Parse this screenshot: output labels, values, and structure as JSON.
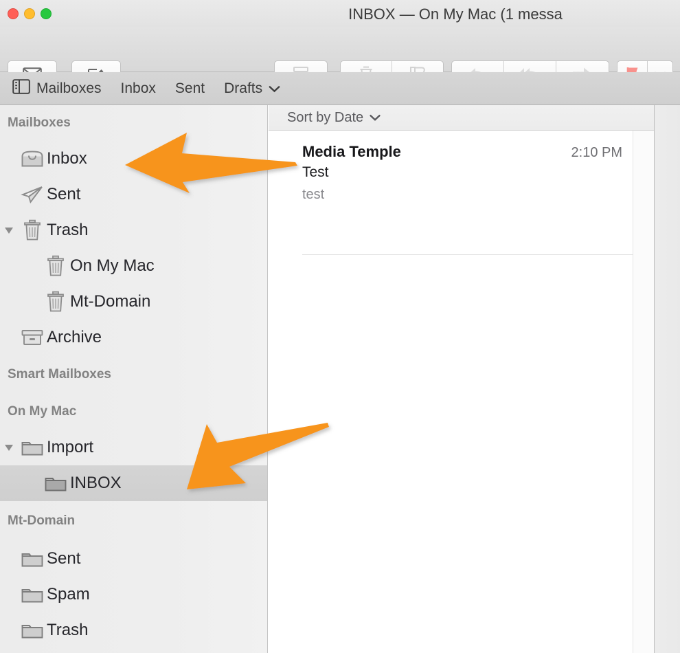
{
  "window": {
    "title": "INBOX — On My Mac (1 messa",
    "traffic_lights": [
      "close-red",
      "minimize-yellow",
      "maximize-green"
    ],
    "colors": {
      "close": "#ff5f57",
      "minimize": "#ffbd2e",
      "maximize": "#28c840",
      "annotation_arrow": "#f7941e",
      "flag": "#f9918c",
      "sidebar_selection": "#d2d2d2"
    }
  },
  "toolbar": {
    "buttons": [
      {
        "name": "get-mail-button",
        "icon": "envelope-icon",
        "label": "Get Mail",
        "enabled": true
      },
      {
        "name": "compose-button",
        "icon": "compose-pencil-icon",
        "label": "New Message",
        "enabled": true
      },
      {
        "name": "archive-button",
        "icon": "archive-box-icon",
        "label": "Archive",
        "enabled": false
      },
      {
        "name": "delete-button",
        "icon": "trash-icon",
        "label": "Delete",
        "enabled": false
      },
      {
        "name": "junk-button",
        "icon": "thumbs-down-icon",
        "label": "Junk",
        "enabled": false
      },
      {
        "name": "reply-button",
        "icon": "reply-arrow-icon",
        "label": "Reply",
        "enabled": false
      },
      {
        "name": "reply-all-button",
        "icon": "reply-all-arrow-icon",
        "label": "Reply All",
        "enabled": false
      },
      {
        "name": "forward-button",
        "icon": "forward-arrow-icon",
        "label": "Forward",
        "enabled": false
      },
      {
        "name": "flag-button",
        "icon": "flag-icon",
        "label": "Flag",
        "enabled": true
      },
      {
        "name": "flag-dropdown-button",
        "icon": "chevron-down-icon",
        "label": "Flag Options",
        "enabled": true
      }
    ]
  },
  "favorites_bar": {
    "sidebar_toggle": {
      "icon": "sidebar-panel-icon",
      "label": ""
    },
    "items": [
      {
        "label": "Mailboxes",
        "icon": "sidebar-panel-icon",
        "active": false
      },
      {
        "label": "Inbox",
        "icon": "",
        "active": false
      },
      {
        "label": "Sent",
        "icon": "",
        "active": false
      },
      {
        "label": "Drafts",
        "icon": "chevron-down-icon",
        "active": false
      }
    ]
  },
  "sidebar": {
    "sections": [
      {
        "header": "Mailboxes",
        "rows": [
          {
            "label": "Inbox",
            "icon": "inbox-tray-icon",
            "indent": 0,
            "disclosure": "",
            "selected": false
          },
          {
            "label": "Sent",
            "icon": "paper-plane-icon",
            "indent": 0,
            "disclosure": "",
            "selected": false
          },
          {
            "label": "Trash",
            "icon": "trash-icon",
            "indent": 0,
            "disclosure": "expanded",
            "selected": false
          },
          {
            "label": "On My Mac",
            "icon": "trash-icon",
            "indent": 2,
            "disclosure": "",
            "selected": false
          },
          {
            "label": "Mt-Domain",
            "icon": "trash-icon",
            "indent": 2,
            "disclosure": "",
            "selected": false
          },
          {
            "label": "Archive",
            "icon": "archive-box-icon",
            "indent": 0,
            "disclosure": "",
            "selected": false
          }
        ]
      },
      {
        "header": "Smart Mailboxes",
        "rows": []
      },
      {
        "header": "On My Mac",
        "rows": [
          {
            "label": "Import",
            "icon": "folder-icon",
            "indent": 0,
            "disclosure": "expanded",
            "selected": false
          },
          {
            "label": "INBOX",
            "icon": "folder-icon",
            "indent": 2,
            "disclosure": "",
            "selected": true
          }
        ]
      },
      {
        "header": "Mt-Domain",
        "rows": [
          {
            "label": "Sent",
            "icon": "folder-icon",
            "indent": 1,
            "disclosure": "",
            "selected": false
          },
          {
            "label": "Spam",
            "icon": "folder-icon",
            "indent": 1,
            "disclosure": "",
            "selected": false
          },
          {
            "label": "Trash",
            "icon": "folder-icon",
            "indent": 1,
            "disclosure": "",
            "selected": false
          }
        ]
      }
    ]
  },
  "message_list": {
    "sort_label": "Sort by Date",
    "sort_chevron": "chevron-down-icon",
    "messages": [
      {
        "sender": "Media Temple",
        "time": "2:10 PM",
        "subject": "Test",
        "preview": "test",
        "unread": true
      }
    ]
  },
  "annotations": [
    {
      "name": "arrow-pointing-to-inbox",
      "direction": "left",
      "target": "sidebar-item-inbox"
    },
    {
      "name": "arrow-pointing-to-import-inbox",
      "direction": "down-left",
      "target": "sidebar-item-import-inbox"
    }
  ]
}
